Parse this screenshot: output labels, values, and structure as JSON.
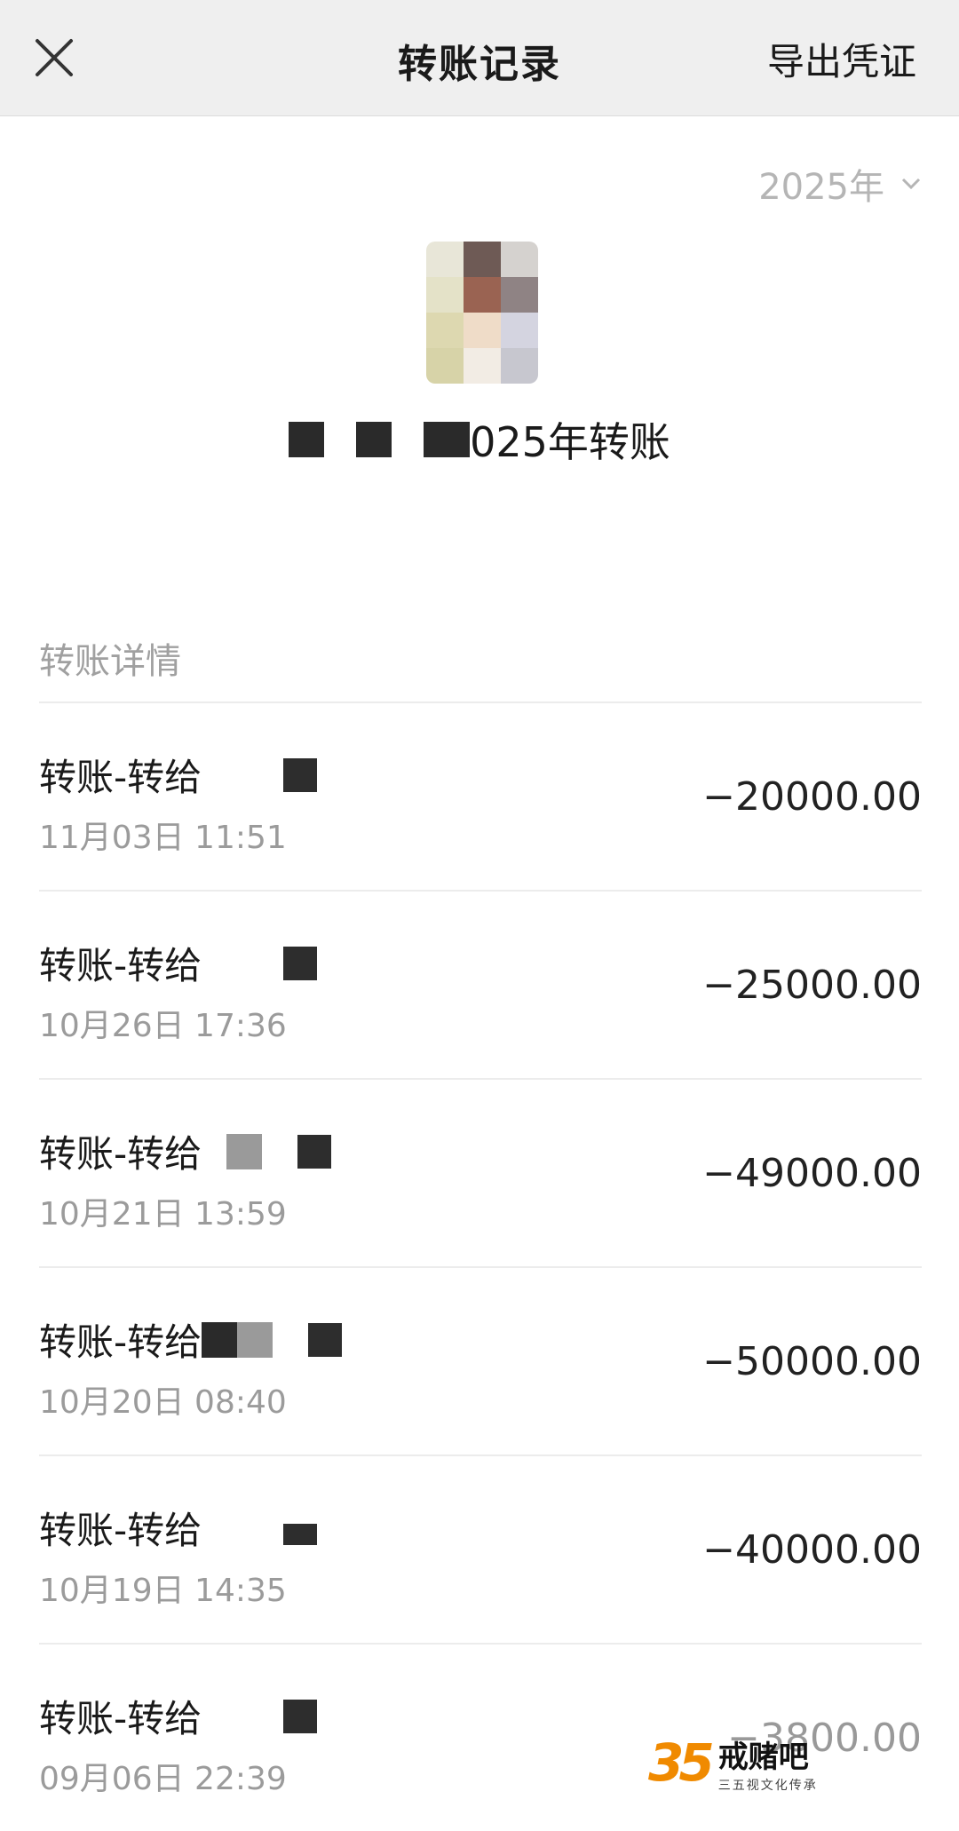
{
  "header": {
    "title": "转账记录",
    "export_label": "导出凭证"
  },
  "year_filter": {
    "value": "2025年"
  },
  "contact": {
    "summary_suffix": "025年转账"
  },
  "section": {
    "label": "转账详情"
  },
  "transactions": [
    {
      "title": "转账-转给",
      "date": "11月03日 11:51",
      "amount": "−20000.00"
    },
    {
      "title": "转账-转给",
      "date": "10月26日 17:36",
      "amount": "−25000.00"
    },
    {
      "title": "转账-转给",
      "date": "10月21日 13:59",
      "amount": "−49000.00"
    },
    {
      "title": "转账-转给",
      "date": "10月20日 08:40",
      "amount": "−50000.00"
    },
    {
      "title": "转账-转给",
      "date": "10月19日 14:35",
      "amount": "−40000.00"
    },
    {
      "title": "转账-转给",
      "date": "09月06日 22:39",
      "amount": "−3800.00"
    }
  ],
  "watermark": {
    "logo": "35",
    "title": "戒赌吧",
    "subtitle": "三五视文化传承"
  },
  "icons": {
    "close": "close-icon",
    "chevron": "chevron-down-icon"
  }
}
